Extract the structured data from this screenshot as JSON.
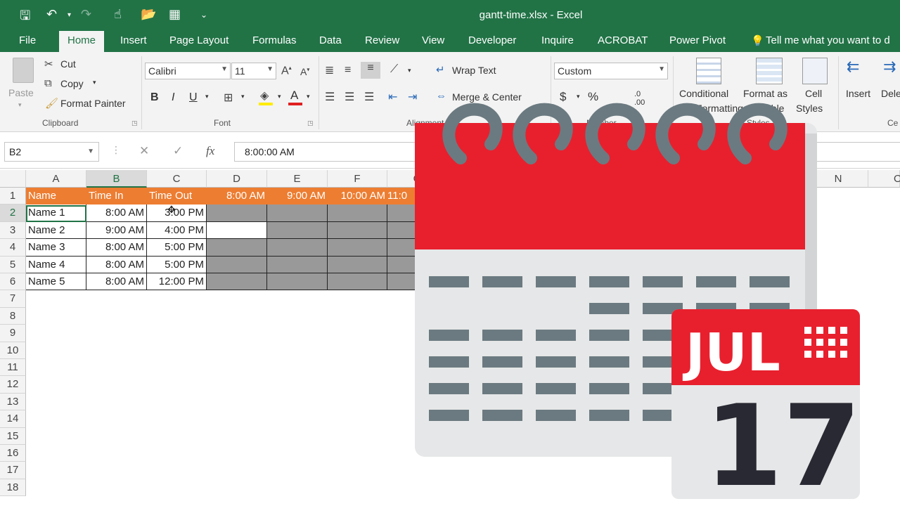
{
  "window": {
    "title": "gantt-time.xlsx - Excel"
  },
  "qat": {
    "save": "save-icon",
    "undo": "undo-icon",
    "redo": "redo-icon",
    "customize": "customize-icon"
  },
  "tabs": [
    "File",
    "Home",
    "Insert",
    "Page Layout",
    "Formulas",
    "Data",
    "Review",
    "View",
    "Developer",
    "Inquire",
    "ACROBAT",
    "Power Pivot"
  ],
  "tellme": "Tell me what you want to d",
  "clipboard": {
    "paste": "Paste",
    "cut": "Cut",
    "copy": "Copy",
    "format_painter": "Format Painter",
    "label": "Clipboard"
  },
  "font": {
    "name": "Calibri",
    "size": "11",
    "label": "Font",
    "bold": "B",
    "italic": "I",
    "underline": "U"
  },
  "alignment": {
    "wrap": "Wrap Text",
    "merge": "Merge & Center",
    "label": "Alignment"
  },
  "number": {
    "format": "Custom",
    "label": "Number",
    "currency": "$",
    "percent": "%"
  },
  "styles": {
    "conditional": "Conditional",
    "conditional2": "Formatting",
    "format_as": "Format as",
    "format_as2": "Table",
    "cell": "Cell",
    "cell2": "Styles",
    "label": "Styles"
  },
  "cells": {
    "insert": "Insert",
    "delete": "Dele",
    "label": "Ce"
  },
  "formula_bar": {
    "name_box": "B2",
    "value": "8:00:00 AM",
    "fx": "fx"
  },
  "columns": [
    "A",
    "B",
    "C",
    "D",
    "E",
    "F",
    "G",
    "N",
    "O"
  ],
  "rows": [
    "1",
    "2",
    "3",
    "4",
    "5",
    "6",
    "7",
    "8",
    "9",
    "10",
    "11",
    "12",
    "13",
    "14",
    "15",
    "16",
    "17",
    "18"
  ],
  "headers": [
    "Name",
    "Time In",
    "Time Out",
    "8:00 AM",
    "9:00 AM",
    "10:00 AM",
    "11:0"
  ],
  "data": [
    [
      "Name 1",
      "8:00 AM",
      "3:00 PM"
    ],
    [
      "Name 2",
      "9:00 AM",
      "4:00 PM"
    ],
    [
      "Name 3",
      "8:00 AM",
      "5:00 PM"
    ],
    [
      "Name 4",
      "8:00 AM",
      "5:00 PM"
    ],
    [
      "Name 5",
      "8:00 AM",
      "12:00 PM"
    ]
  ],
  "overlay": {
    "month": "JUL",
    "day": "17",
    "colors": {
      "red": "#e8202e",
      "gray": "#6b7a80",
      "light": "#e6e7e8",
      "dark": "#292933"
    }
  },
  "theme": {
    "excel_green": "#217346",
    "header_orange": "#ed7d31",
    "gantt_gray": "#999999"
  }
}
